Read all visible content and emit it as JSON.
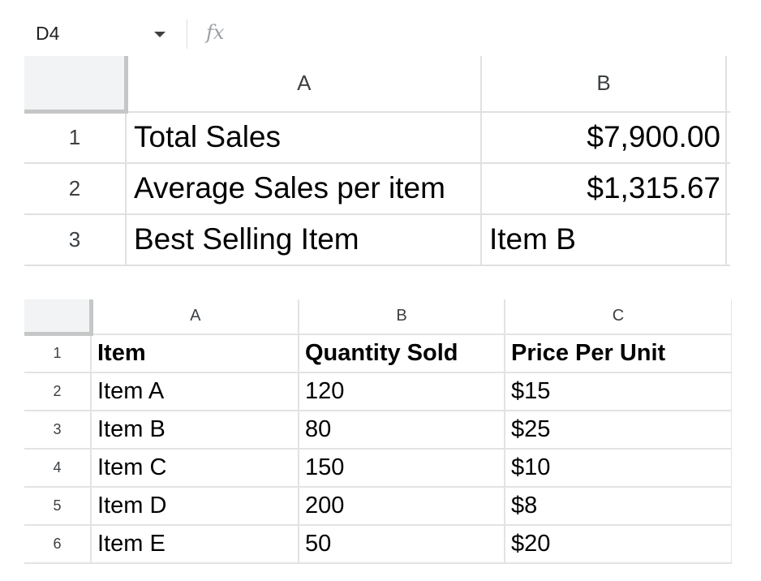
{
  "formula_bar": {
    "name_box": "D4",
    "fx_label": "fx",
    "formula": ""
  },
  "sheet1": {
    "columns": [
      "A",
      "B"
    ],
    "rows": [
      {
        "num": "1",
        "a": "Total Sales",
        "b": "$7,900.00"
      },
      {
        "num": "2",
        "a": "Average Sales per item",
        "b": "$1,315.67"
      },
      {
        "num": "3",
        "a": "Best Selling Item",
        "b": "Item B"
      }
    ]
  },
  "sheet2": {
    "columns": [
      "A",
      "B",
      "C"
    ],
    "rows": [
      {
        "num": "1",
        "a": "Item",
        "b": "Quantity Sold",
        "c": "Price Per Unit"
      },
      {
        "num": "2",
        "a": "Item A",
        "b": "120",
        "c": "$15"
      },
      {
        "num": "3",
        "a": "Item B",
        "b": "80",
        "c": "$25"
      },
      {
        "num": "4",
        "a": "Item C",
        "b": "150",
        "c": "$10"
      },
      {
        "num": "5",
        "a": "Item D",
        "b": "200",
        "c": "$8"
      },
      {
        "num": "6",
        "a": "Item E",
        "b": "50",
        "c": "$20"
      }
    ]
  }
}
